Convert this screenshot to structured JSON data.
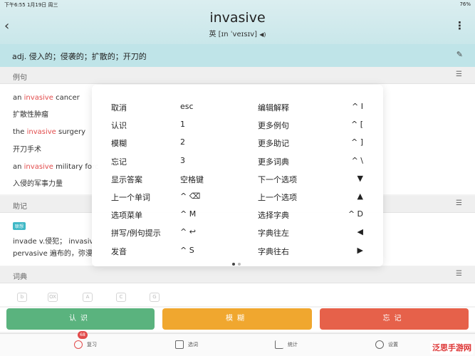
{
  "status": {
    "left": "下午6:55  1月19日 周三",
    "right": "76%"
  },
  "header": {
    "back_icon": "‹",
    "word": "invasive",
    "phonetic": "英 [ɪn ˈveɪsɪv]",
    "more_icon": "⋮"
  },
  "definition": {
    "text": "adj. 侵入的；侵袭的；扩散的；开刀的",
    "edit_icon": "✎"
  },
  "sections": {
    "examples": "例句",
    "mnemonic": "助记",
    "dictionary": "词典",
    "menu_icon": "☰"
  },
  "examples": [
    {
      "before": "an ",
      "hl": "invasive",
      "after": " cancer",
      "trans": "扩散性肿瘤"
    },
    {
      "before": "the ",
      "hl": "invasive",
      "after": " surgery",
      "trans": "开刀手术"
    },
    {
      "before": "an ",
      "hl": "invasive",
      "after": " military forc",
      "trans": "入侵的军事力量"
    }
  ],
  "mnemonic": {
    "tag": "联想",
    "line1": "invade v.侵犯；  invasiv",
    "line2": "pervasive 遍布的，弥漫"
  },
  "dict_icons": [
    "b",
    "OX",
    "A",
    "C",
    "G"
  ],
  "actions": {
    "know": "认识",
    "fuzzy": "模糊",
    "forget": "忘记"
  },
  "tabs": {
    "review": "复习",
    "lists": "选词",
    "stats": "统计",
    "settings": "设置",
    "badge": "68"
  },
  "logo": "泛思手游网",
  "shortcuts": {
    "left": [
      {
        "label": "取消",
        "key": "esc"
      },
      {
        "label": "认识",
        "key": "1"
      },
      {
        "label": "模糊",
        "key": "2"
      },
      {
        "label": "忘记",
        "key": "3"
      },
      {
        "label": "显示答案",
        "key": "空格键"
      },
      {
        "label": "上一个单词",
        "key": "^ ⌫"
      },
      {
        "label": "选项菜单",
        "key": "^ M"
      },
      {
        "label": "拼写/例句提示",
        "key": "^ ↩"
      },
      {
        "label": "发音",
        "key": "^ S"
      }
    ],
    "right": [
      {
        "label": "编辑解释",
        "key": "^ I"
      },
      {
        "label": "更多例句",
        "key": "^ ["
      },
      {
        "label": "更多助记",
        "key": "^ ]"
      },
      {
        "label": "更多词典",
        "key": "^ \\"
      },
      {
        "label": "下一个选项",
        "key": "▼"
      },
      {
        "label": "上一个选项",
        "key": "▲"
      },
      {
        "label": "选择字典",
        "key": "^ D"
      },
      {
        "label": "字典往左",
        "key": "◀"
      },
      {
        "label": "字典往右",
        "key": "▶"
      }
    ]
  },
  "colors": {
    "know": "#5ab37e",
    "fuzzy": "#f0a72f",
    "forget": "#e6614a",
    "highlight": "#e24b4b"
  }
}
